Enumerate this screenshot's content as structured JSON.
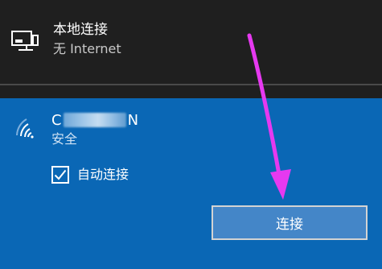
{
  "wired": {
    "icon": "wired-network-icon",
    "title": "本地连接",
    "status": "无 Internet"
  },
  "wifi": {
    "icon": "wifi-signal-icon",
    "ssid_start": "C",
    "ssid_end": "N",
    "security": "安全",
    "auto_connect_label": "自动连接",
    "auto_connect_checked": true,
    "connect_button": "连接"
  },
  "colors": {
    "background": "#1f1f1f",
    "panel_blue": "#0a67b5",
    "button_fill": "#4486c8",
    "annotation_arrow": "#e639f0"
  }
}
